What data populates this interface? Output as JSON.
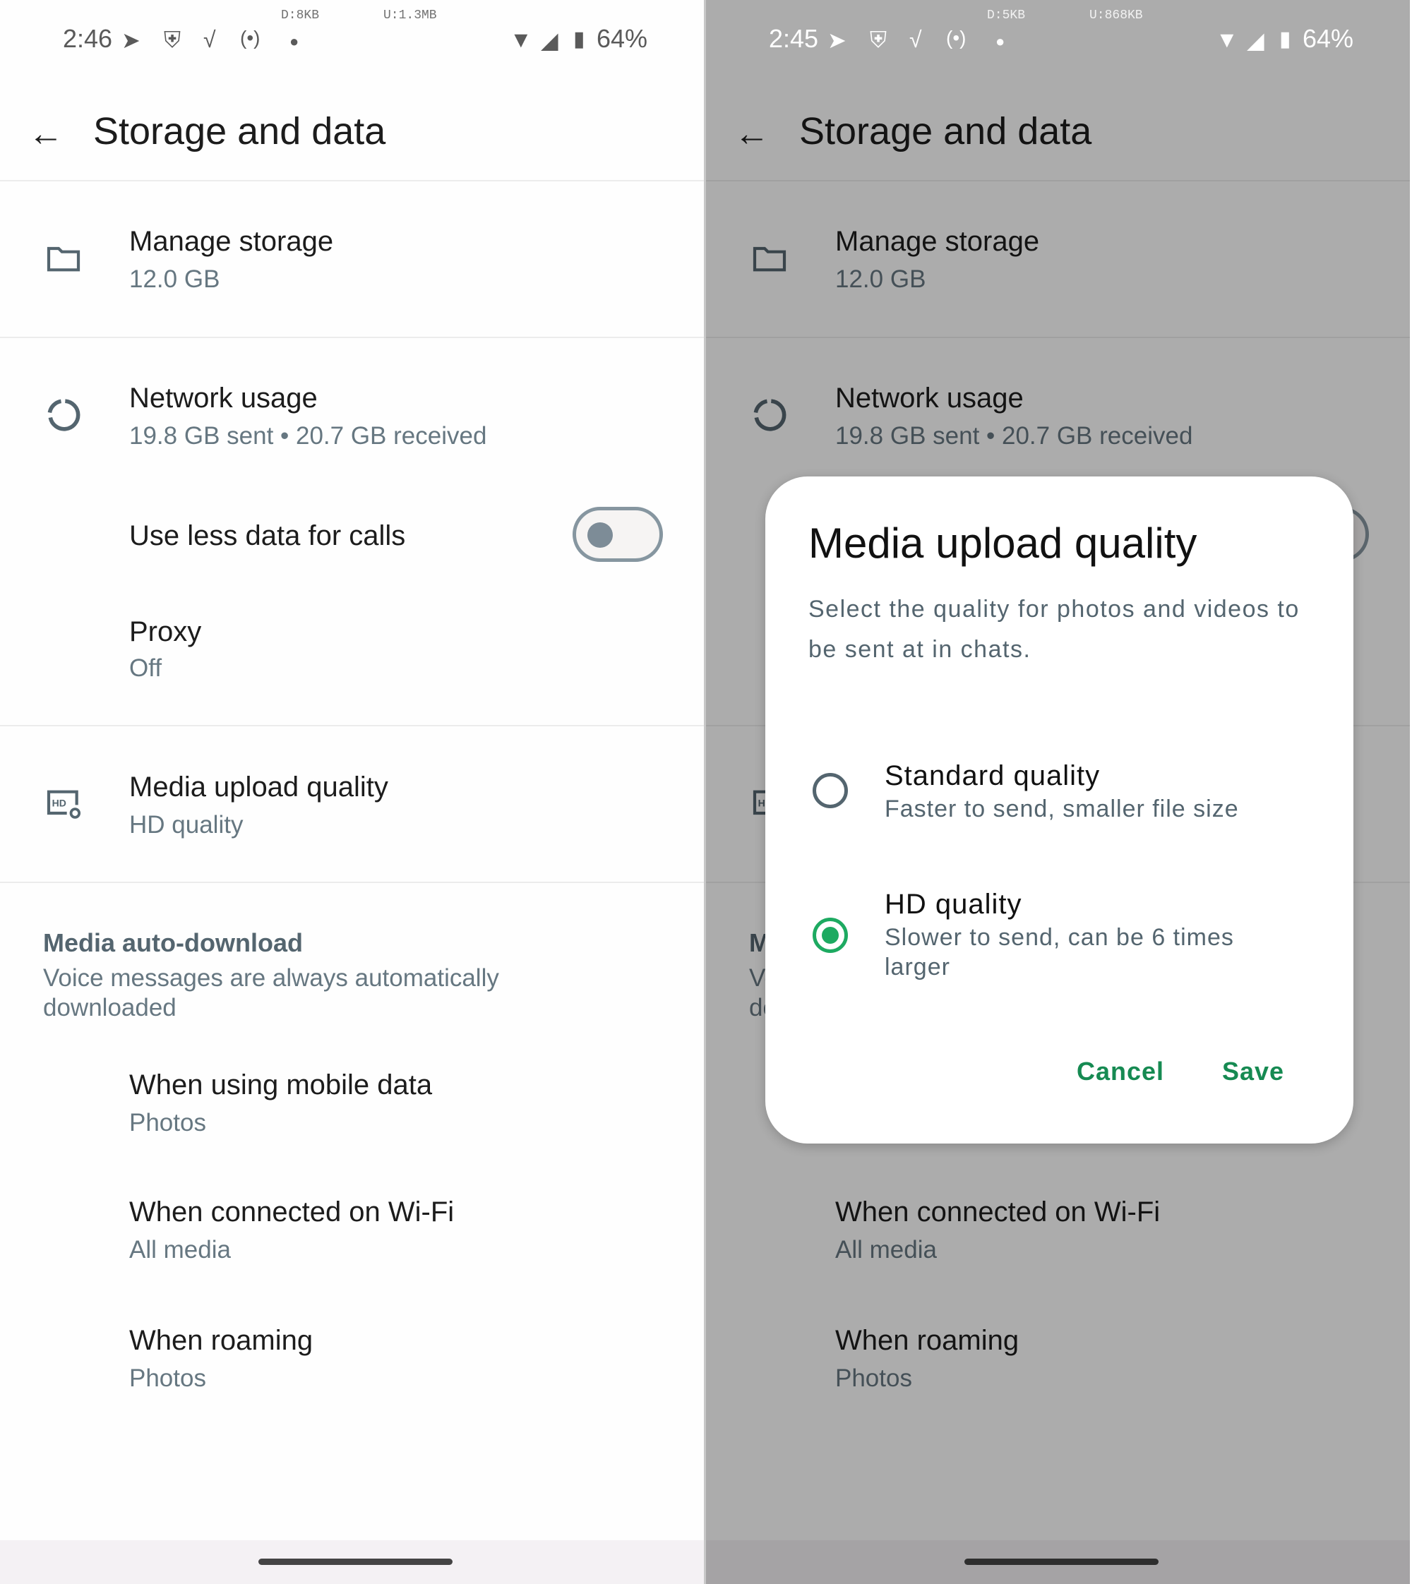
{
  "status_left": {
    "time": "2:46",
    "download": "D:8KB",
    "upload": "U:1.3MB",
    "battery": "64%"
  },
  "status_right": {
    "time": "2:45",
    "download": "D:5KB",
    "upload": "U:868KB",
    "battery": "64%"
  },
  "status_icons": [
    "telegram-icon",
    "shield-g-icon",
    "bird-icon",
    "hotspot-icon",
    "dot-icon",
    "wifi-icon",
    "signal-icon",
    "battery-charging-icon"
  ],
  "header": {
    "title": "Storage and data",
    "back_icon": "arrow-left-icon"
  },
  "settings": {
    "manage_storage": {
      "title": "Manage storage",
      "subtitle": "12.0 GB",
      "icon": "folder-icon"
    },
    "network_usage": {
      "title": "Network usage",
      "subtitle": "19.8 GB sent • 20.7 GB received",
      "icon": "data-usage-icon"
    },
    "less_data_calls": {
      "title": "Use less data for calls",
      "enabled": false
    },
    "proxy": {
      "title": "Proxy",
      "subtitle": "Off"
    },
    "media_upload_quality": {
      "title": "Media upload quality",
      "subtitle": "HD quality",
      "icon": "hd-settings-icon"
    },
    "auto_download": {
      "header": "Media auto-download",
      "note": "Voice messages are always automatically downloaded",
      "mobile": {
        "title": "When using mobile data",
        "subtitle": "Photos"
      },
      "wifi": {
        "title": "When connected on Wi-Fi",
        "subtitle": "All media"
      },
      "roaming": {
        "title": "When roaming",
        "subtitle": "Photos"
      }
    }
  },
  "dialog": {
    "title": "Media upload quality",
    "description": "Select the quality for photos and videos to be sent at in chats.",
    "options": [
      {
        "label": "Standard quality",
        "description": "Faster to send, smaller file size",
        "selected": false
      },
      {
        "label": "HD quality",
        "description": "Slower to send, can be 6 times larger",
        "selected": true
      }
    ],
    "cancel_label": "Cancel",
    "save_label": "Save"
  },
  "colors": {
    "accent": "#1daa61",
    "button_text": "#168a52",
    "toggle_off": "#7d8c97",
    "scrim": "rgba(0,0,0,0.32)"
  }
}
